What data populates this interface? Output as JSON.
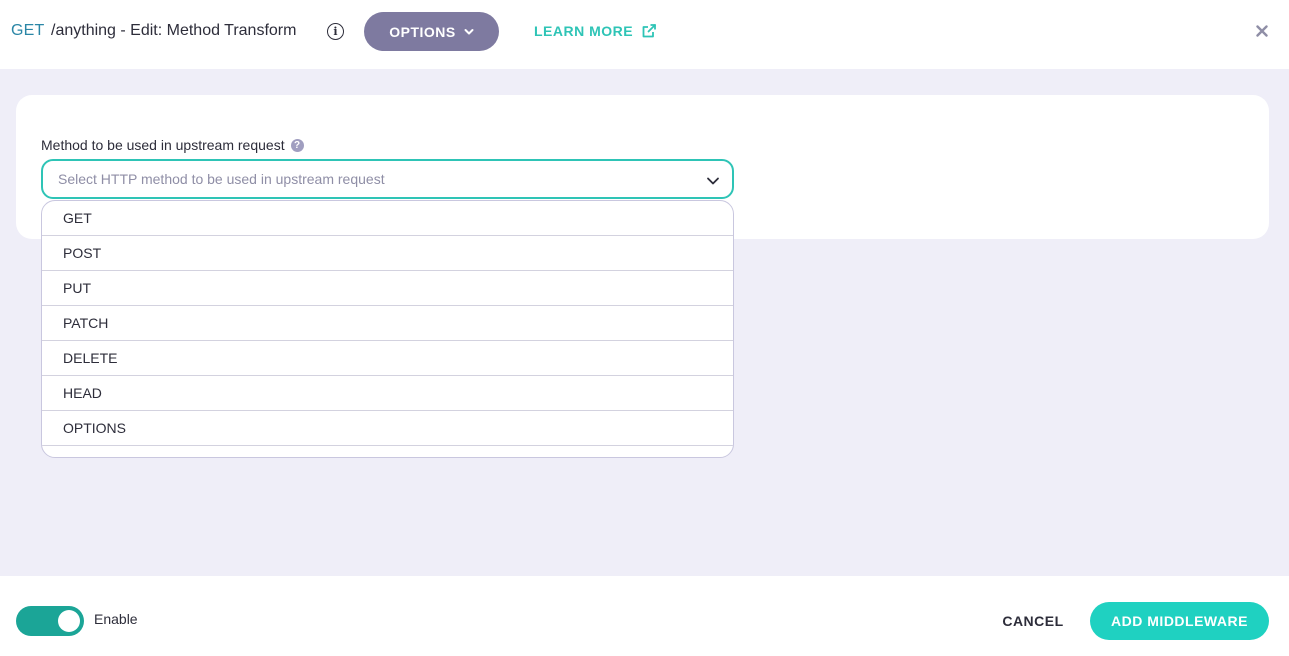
{
  "header": {
    "method": "GET",
    "title": "/anything - Edit: Method Transform",
    "info_icon": "info-icon",
    "options_label": "OPTIONS",
    "learn_more_label": "LEARN MORE",
    "learn_more_icon": "external-link-icon",
    "close_icon": "close-icon"
  },
  "form": {
    "label": "Method to be used in upstream request",
    "help_icon": "question-icon",
    "select_placeholder": "Select HTTP method to be used in upstream request",
    "options": [
      "GET",
      "POST",
      "PUT",
      "PATCH",
      "DELETE",
      "HEAD",
      "OPTIONS"
    ]
  },
  "footer": {
    "enable_label": "Enable",
    "enabled": true,
    "cancel_label": "CANCEL",
    "add_label": "ADD MIDDLEWARE"
  },
  "colors": {
    "accent": "#2ec4b6",
    "primary_button": "#1fd1c1",
    "toggle_on": "#1ba597",
    "options_button": "#7e7aa0",
    "method_text": "#2a86a6",
    "background": "#efeef8"
  }
}
